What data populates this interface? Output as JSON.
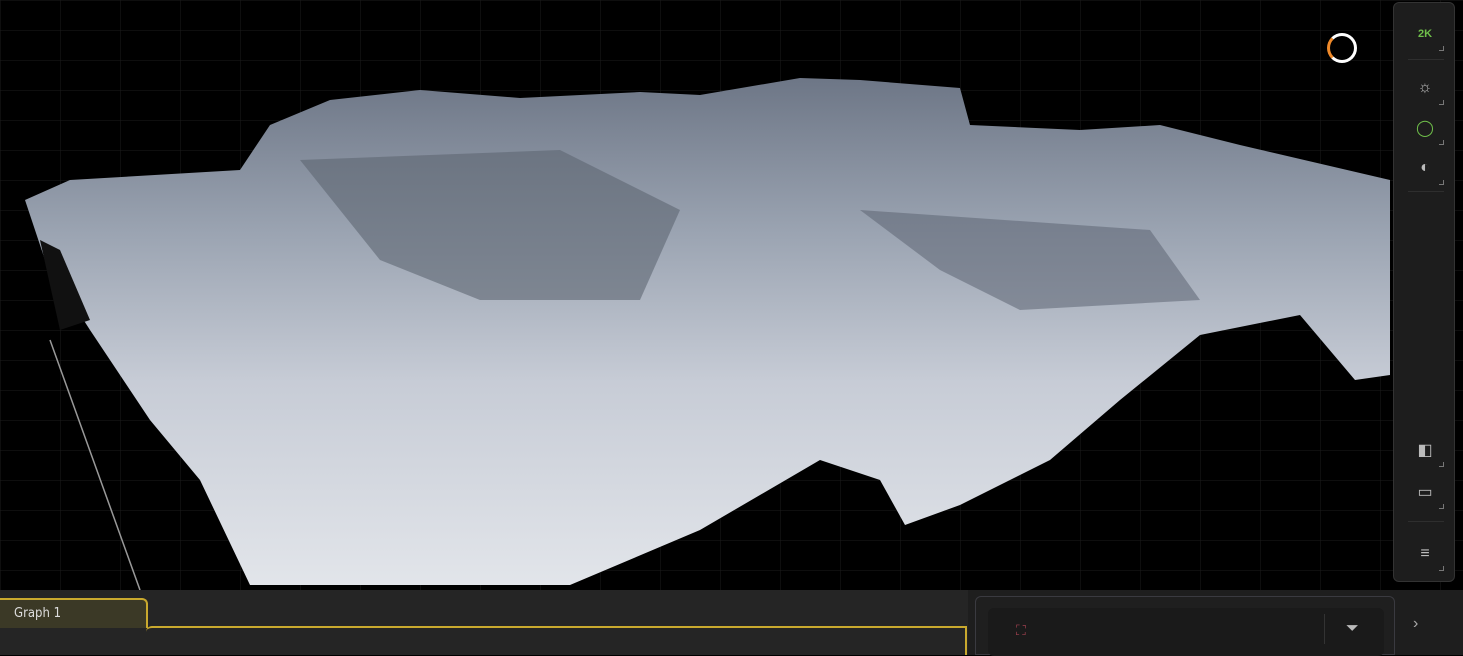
{
  "toolbar": {
    "resolution_label": "2K",
    "icons": [
      "sun-icon",
      "color-circle-icon",
      "shading-icon",
      "split-view-icon",
      "ruler-icon",
      "menu-icon"
    ]
  },
  "graph": {
    "tab_label": "Graph 1"
  },
  "panel": {
    "expand_icon": "›"
  },
  "colors": {
    "accent": "#c9a92e",
    "green": "#6fbf4a"
  }
}
